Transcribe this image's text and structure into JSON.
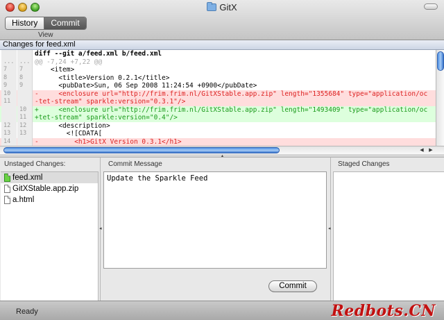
{
  "window": {
    "title": "GitX"
  },
  "toolbar": {
    "segments": [
      {
        "label": "History",
        "active": false
      },
      {
        "label": "Commit",
        "active": true
      }
    ],
    "view_label": "View"
  },
  "diff": {
    "header": "Changes for feed.xml",
    "lines": [
      {
        "type": "header",
        "old": "",
        "new": "",
        "text": "diff --git a/feed.xml b/feed.xml"
      },
      {
        "type": "hunk",
        "old": "...",
        "new": "...",
        "text": "@@ -7,24 +7,22 @@"
      },
      {
        "type": "context",
        "old": "7",
        "new": "7",
        "text": "    <item>"
      },
      {
        "type": "context",
        "old": "8",
        "new": "8",
        "text": "      <title>Version 0.2.1</title>"
      },
      {
        "type": "context",
        "old": "9",
        "new": "9",
        "text": "      <pubDate>Sun, 06 Sep 2008 11:24:54 +0900</pubDate>"
      },
      {
        "type": "removed",
        "old": "10",
        "new": "",
        "text": "-     <enclosure url=\"http://frim.frim.nl/GitXStable.app.zip\" length=\"1355684\" type=\"application/oc"
      },
      {
        "type": "removed",
        "old": "11",
        "new": "",
        "text": "-tet-stream\" sparkle:version=\"0.3.1\"/>"
      },
      {
        "type": "added",
        "old": "",
        "new": "10",
        "text": "+     <enclosure url=\"http://frim.frim.nl/GitXStable.app.zip\" length=\"1493409\" type=\"application/oc"
      },
      {
        "type": "added",
        "old": "",
        "new": "11",
        "text": "+tet-stream\" sparkle:version=\"0.4\"/>"
      },
      {
        "type": "context",
        "old": "12",
        "new": "12",
        "text": "      <description>"
      },
      {
        "type": "context",
        "old": "13",
        "new": "13",
        "text": "        <![CDATA["
      },
      {
        "type": "removed",
        "old": "14",
        "new": "",
        "text": "-         <h1>GitX Version 0.3.1</h1>"
      }
    ]
  },
  "unstaged": {
    "label": "Unstaged Changes:",
    "files": [
      {
        "name": "feed.xml",
        "icon": "green",
        "selected": true
      },
      {
        "name": "GitXStable.app.zip",
        "icon": "plain",
        "selected": false
      },
      {
        "name": "a.html",
        "icon": "plain",
        "selected": false
      }
    ]
  },
  "commit": {
    "label": "Commit Message",
    "message": "Update the Sparkle Feed",
    "button": "Commit"
  },
  "staged": {
    "label": "Staged Changes"
  },
  "status": {
    "text": "Ready"
  },
  "watermark": "Redbots.CN"
}
